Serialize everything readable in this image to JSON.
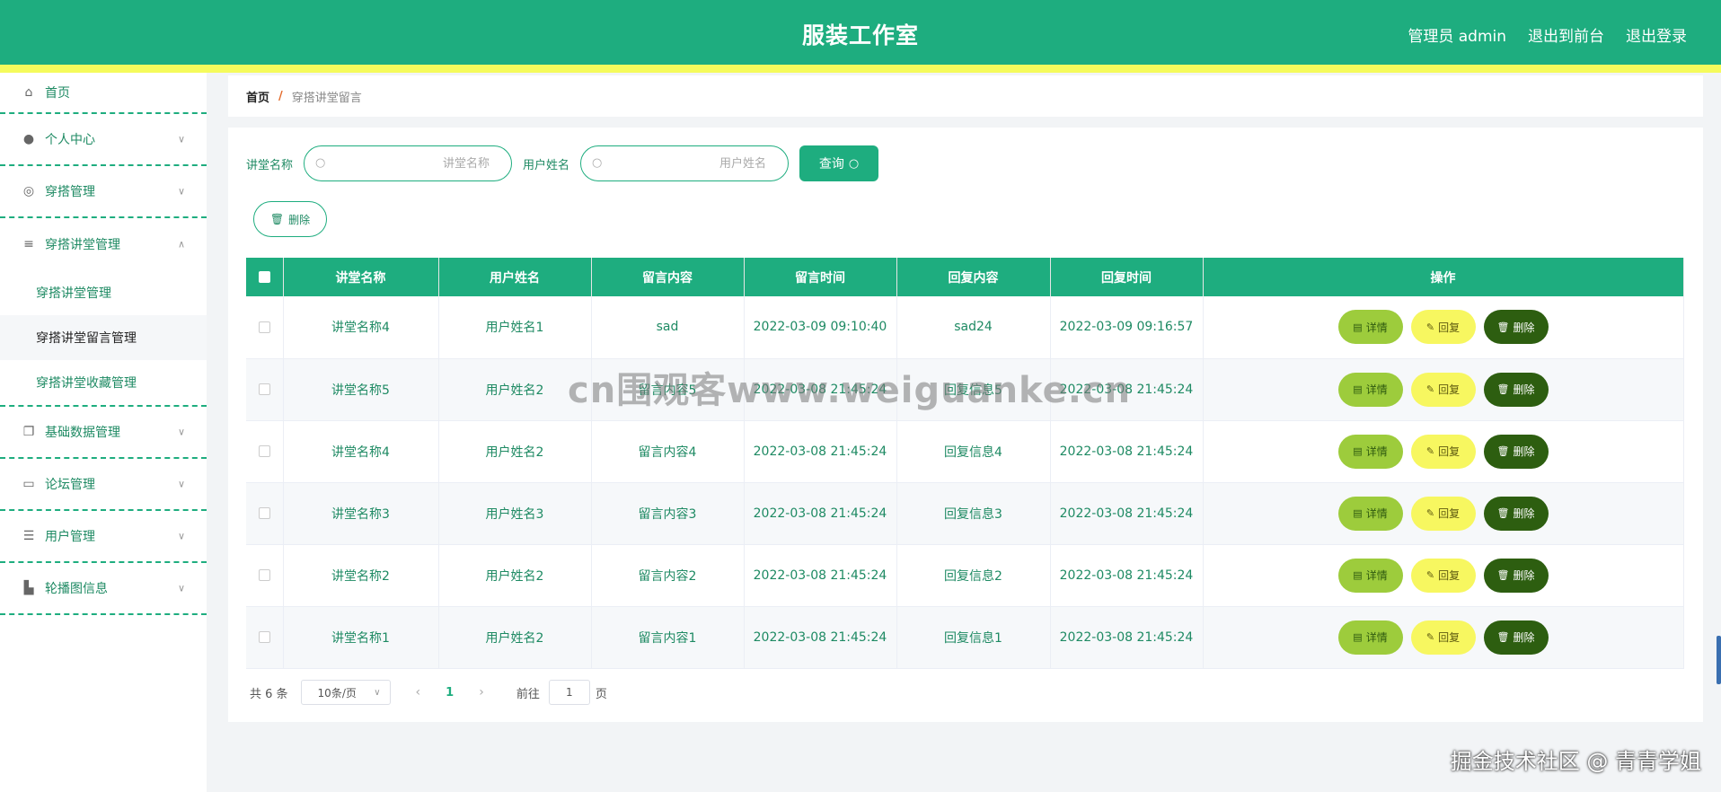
{
  "header": {
    "title": "服装工作室",
    "user_label": "管理员 admin",
    "front_link": "退出到前台",
    "logout_link": "退出登录"
  },
  "sidebar": {
    "items": [
      {
        "label": "首页",
        "icon": "home-icon"
      },
      {
        "label": "个人中心",
        "icon": "user-icon"
      },
      {
        "label": "穿搭管理",
        "icon": "lifebuoy-icon"
      },
      {
        "label": "穿搭讲堂管理",
        "icon": "menu-icon",
        "expanded": true,
        "children": [
          "穿搭讲堂管理",
          "穿搭讲堂留言管理",
          "穿搭讲堂收藏管理"
        ]
      },
      {
        "label": "基础数据管理",
        "icon": "copy-icon"
      },
      {
        "label": "论坛管理",
        "icon": "forum-icon"
      },
      {
        "label": "用户管理",
        "icon": "list-icon"
      },
      {
        "label": "轮播图信息",
        "icon": "suitcase-icon"
      }
    ]
  },
  "breadcrumb": {
    "home": "首页",
    "separator": "/",
    "current": "穿搭讲堂留言"
  },
  "search": {
    "field1_label": "讲堂名称",
    "field1_placeholder": "讲堂名称",
    "field2_label": "用户姓名",
    "field2_placeholder": "用户姓名",
    "query_label": "查询"
  },
  "toolbar": {
    "delete_label": "删除"
  },
  "table": {
    "headers": [
      "讲堂名称",
      "用户姓名",
      "留言内容",
      "留言时间",
      "回复内容",
      "回复时间",
      "操作"
    ],
    "rows": [
      [
        "讲堂名称4",
        "用户姓名1",
        "sad",
        "2022-03-09 09:10:40",
        "sad24",
        "2022-03-09 09:16:57"
      ],
      [
        "讲堂名称5",
        "用户姓名2",
        "留言内容5",
        "2022-03-08 21:45:24",
        "回复信息5",
        "2022-03-08 21:45:24"
      ],
      [
        "讲堂名称4",
        "用户姓名2",
        "留言内容4",
        "2022-03-08 21:45:24",
        "回复信息4",
        "2022-03-08 21:45:24"
      ],
      [
        "讲堂名称3",
        "用户姓名3",
        "留言内容3",
        "2022-03-08 21:45:24",
        "回复信息3",
        "2022-03-08 21:45:24"
      ],
      [
        "讲堂名称2",
        "用户姓名2",
        "留言内容2",
        "2022-03-08 21:45:24",
        "回复信息2",
        "2022-03-08 21:45:24"
      ],
      [
        "讲堂名称1",
        "用户姓名2",
        "留言内容1",
        "2022-03-08 21:45:24",
        "回复信息1",
        "2022-03-08 21:45:24"
      ]
    ],
    "actions": {
      "detail": "详情",
      "reply": "回复",
      "delete": "删除"
    }
  },
  "pagination": {
    "total": "共 6 条",
    "page_size": "10条/页",
    "current_page": "1",
    "goto_label": "前往",
    "goto_value": "1",
    "page_unit": "页"
  },
  "watermarks": {
    "center": "cn围观客www.weiguanke.cn",
    "corner": "掘金技术社区 @ 青青学姐"
  },
  "colors": {
    "primary": "#1ead7f",
    "accent_strip": "#f5fb5c",
    "detail_btn": "#9dcc3c",
    "reply_btn": "#f7f760",
    "delete_btn": "#2d5e10"
  }
}
